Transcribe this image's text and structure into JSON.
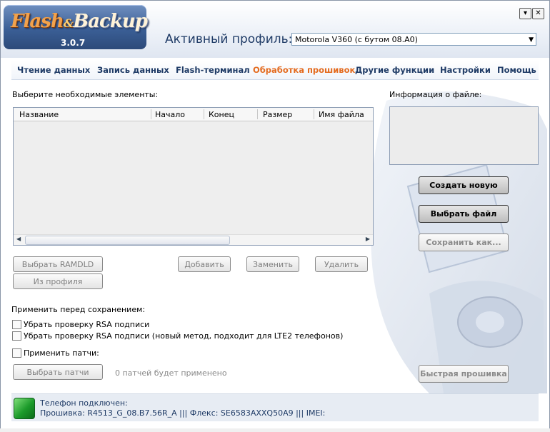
{
  "app": {
    "logo_part1": "Flash",
    "logo_amp": "&",
    "logo_part2": "Backup",
    "version": "3.0.7"
  },
  "window_buttons": {
    "minimize": "▾",
    "close": "✕"
  },
  "profile": {
    "label": "Активный профиль:",
    "selected": "Motorola V360 (с бутом 08.A0)"
  },
  "menu": [
    {
      "label": "Чтение данных"
    },
    {
      "label": "Запись данных"
    },
    {
      "label": "Flash-терминал"
    },
    {
      "label": "Обработка прошивок",
      "active": true
    },
    {
      "label": "Другие функции"
    },
    {
      "label": "Настройки"
    },
    {
      "label": "Помощь"
    }
  ],
  "main": {
    "elements_label": "Выберите необходимые элементы:",
    "columns": [
      "Название",
      "Начало",
      "Конец",
      "Размер",
      "Имя файла"
    ],
    "rows": [],
    "buttons": {
      "select_ramdld": "Выбрать RAMDLD",
      "from_profile": "Из профиля",
      "add": "Добавить",
      "replace": "Заменить",
      "delete": "Удалить"
    },
    "apply_label": "Применить перед сохранением:",
    "options": [
      {
        "label": "Убрать проверку RSA подписи",
        "checked": false
      },
      {
        "label": "Убрать проверку RSA подписи (новый метод, подходит для LTE2 телефонов)",
        "checked": false
      }
    ],
    "patches": {
      "label": "Применить патчи:",
      "checked": false,
      "button": "Выбрать патчи",
      "count_text": "0 патчей будет применено"
    }
  },
  "side": {
    "info_label": "Информация о файле:",
    "create_new": "Создать новую",
    "select_file": "Выбрать файл",
    "save_as": "Сохранить как...",
    "quick_flash": "Быстрая прошивка"
  },
  "status": {
    "line1": "Телефон подключен:",
    "line2": "Прошивка: R4513_G_08.B7.56R_A ||| Флекс: SE6583AXXQ50A9 ||| IMEI:"
  },
  "colors": {
    "accent": "#e46b1f",
    "nav": "#1f3b66",
    "led": "#1b9a2a"
  }
}
